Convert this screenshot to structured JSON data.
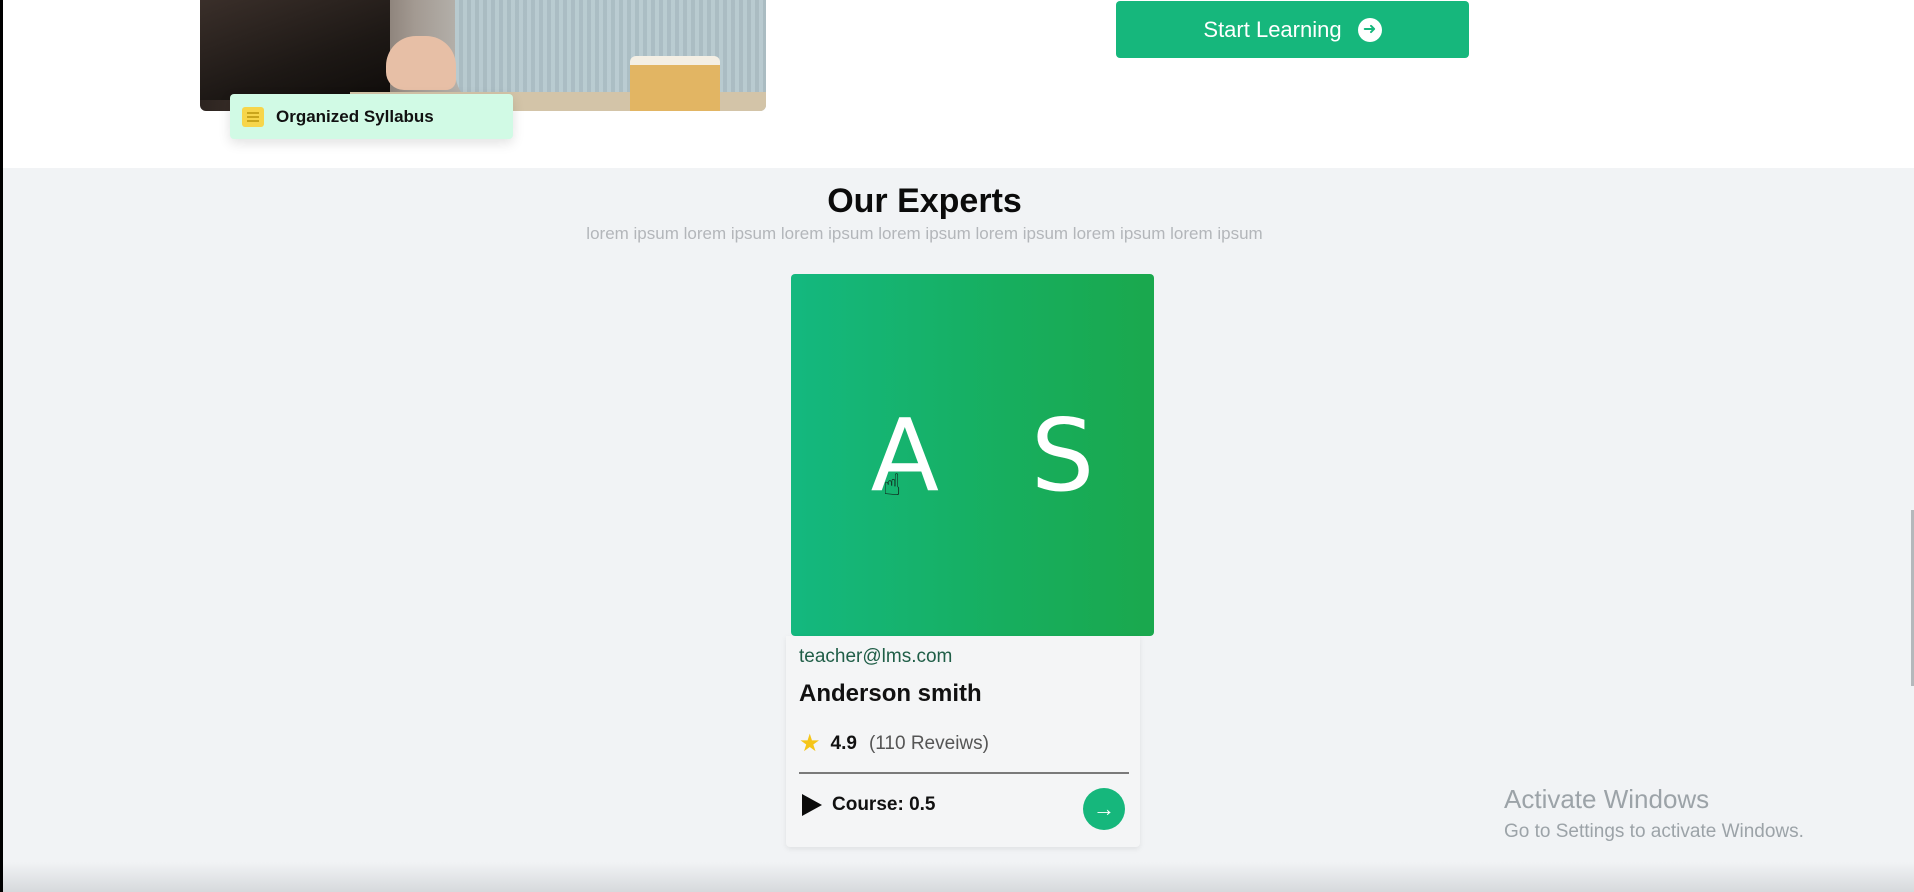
{
  "hero": {
    "badge_label": "Organized Syllabus",
    "start_button_label": "Start Learning"
  },
  "experts": {
    "title": "Our Experts",
    "subtitle": "lorem ipsum lorem ipsum lorem ipsum lorem ipsum lorem ipsum lorem ipsum lorem ipsum",
    "cards": [
      {
        "initials": "A S",
        "email": "teacher@lms.com",
        "name": "Anderson smith",
        "rating": "4.9",
        "reviews": "(110 Reveiws)",
        "course": "Course: 0.5"
      }
    ]
  },
  "windows_notice": {
    "title": "Activate Windows",
    "subtitle": "Go to Settings to activate Windows."
  },
  "colors": {
    "accent": "#16b77c",
    "badge_bg": "#d1fae5",
    "section_bg": "#f1f3f5"
  }
}
